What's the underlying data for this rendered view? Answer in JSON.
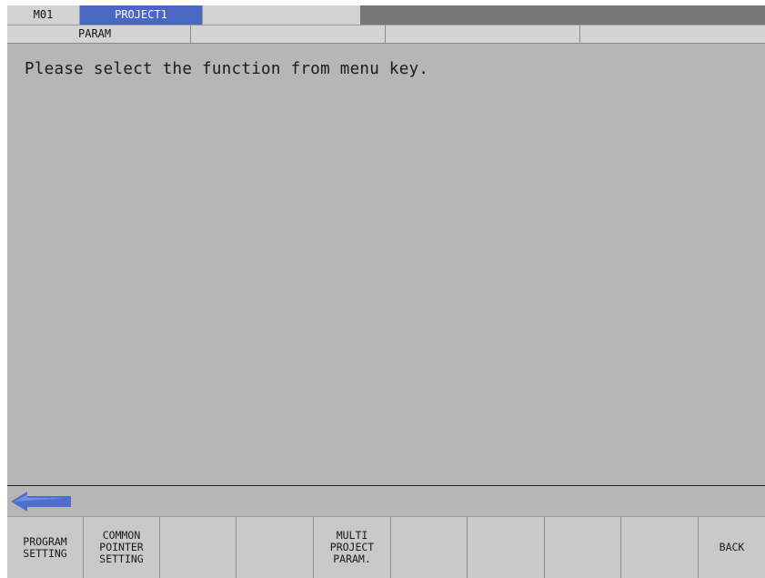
{
  "header": {
    "machine": "M01",
    "project": "PROJECT1",
    "empty_tab": ""
  },
  "subheader": {
    "segments": [
      "PARAM",
      "",
      "",
      ""
    ]
  },
  "main": {
    "message": "Please select the function from menu key."
  },
  "colors": {
    "screen_bg": "#b6b6b6",
    "project_tab": "#4a67c4",
    "arrow": "#4f6fd0"
  },
  "icons": {
    "back_arrow": "left-arrow-icon"
  },
  "softkeys": [
    {
      "label": "PROGRAM\nSETTING"
    },
    {
      "label": "COMMON\nPOINTER\nSETTING"
    },
    {
      "label": ""
    },
    {
      "label": ""
    },
    {
      "label": "MULTI\nPROJECT\nPARAM."
    },
    {
      "label": ""
    },
    {
      "label": ""
    },
    {
      "label": ""
    },
    {
      "label": ""
    },
    {
      "label": "BACK"
    }
  ]
}
